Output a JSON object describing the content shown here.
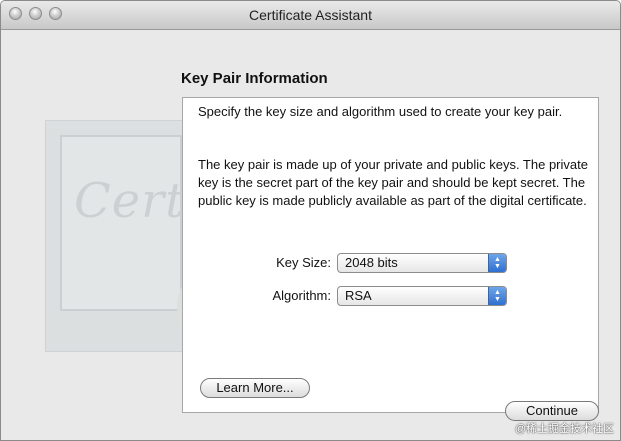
{
  "window": {
    "title": "Certificate Assistant"
  },
  "section": {
    "heading": "Key Pair Information"
  },
  "panel": {
    "intro": "Specify the key size and algorithm used to create your key pair.",
    "explanation": "The key pair is made up of your private and public keys. The private key is the secret part of the key pair and should be kept secret. The public key is made publicly available as part of the digital certificate.",
    "key_size": {
      "label": "Key Size:",
      "value": "2048 bits"
    },
    "algorithm": {
      "label": "Algorithm:",
      "value": "RSA"
    },
    "learn_more": "Learn More..."
  },
  "footer": {
    "continue": "Continue"
  },
  "background_art": {
    "script_text": "Certif"
  },
  "watermark": "@稀土掘金技术社区",
  "icons": {
    "window_buttons": [
      "close-icon",
      "minimize-icon",
      "zoom-icon"
    ],
    "popup_arrows": "up-down-arrows-icon"
  }
}
